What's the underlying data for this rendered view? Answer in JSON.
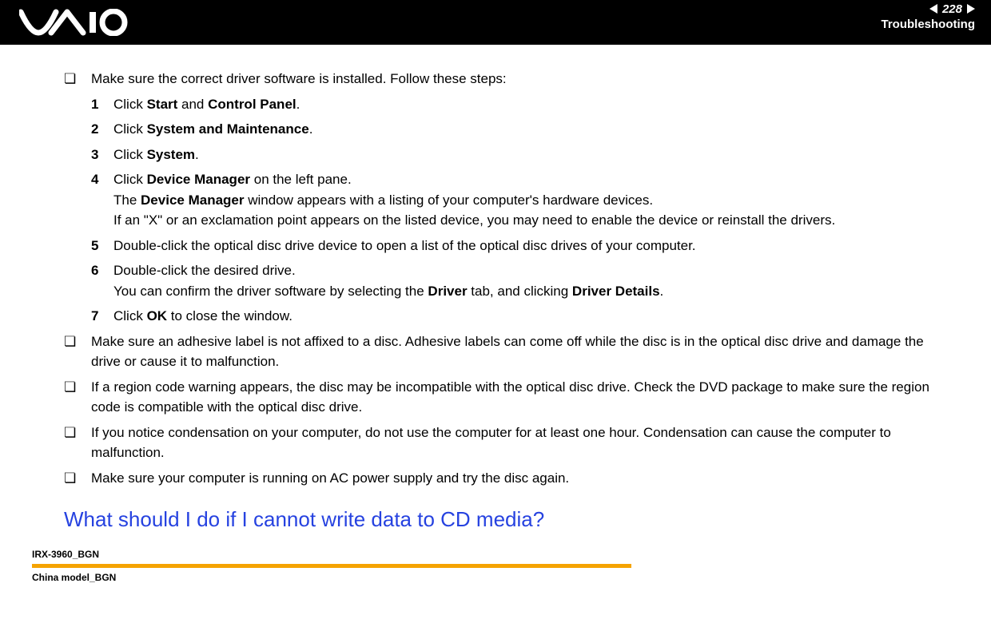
{
  "header": {
    "logo_text": "VAIO",
    "page_number": "228",
    "section": "Troubleshooting"
  },
  "content": {
    "bullet1": {
      "intro": "Make sure the correct driver software is installed. Follow these steps:",
      "steps": {
        "s1": {
          "num": "1",
          "pre": "Click ",
          "b1": "Start",
          "mid": " and ",
          "b2": "Control Panel",
          "post": "."
        },
        "s2": {
          "num": "2",
          "pre": "Click ",
          "b1": "System and Maintenance",
          "post": "."
        },
        "s3": {
          "num": "3",
          "pre": "Click ",
          "b1": "System",
          "post": "."
        },
        "s4": {
          "num": "4",
          "line1_pre": "Click ",
          "line1_b": "Device Manager",
          "line1_post": " on the left pane.",
          "line2_pre": "The ",
          "line2_b": "Device Manager",
          "line2_post": " window appears with a listing of your computer's hardware devices.",
          "line3": "If an \"X\" or an exclamation point appears on the listed device, you may need to enable the device or reinstall the drivers."
        },
        "s5": {
          "num": "5",
          "text": "Double-click the optical disc drive device to open a list of the optical disc drives of your computer."
        },
        "s6": {
          "num": "6",
          "line1": "Double-click the desired drive.",
          "line2_pre": "You can confirm the driver software by selecting the ",
          "line2_b1": "Driver",
          "line2_mid": " tab, and clicking ",
          "line2_b2": "Driver Details",
          "line2_post": "."
        },
        "s7": {
          "num": "7",
          "pre": "Click ",
          "b1": "OK",
          "post": " to close the window."
        }
      }
    },
    "bullet2": "Make sure an adhesive label is not affixed to a disc. Adhesive labels can come off while the disc is in the optical disc drive and damage the drive or cause it to malfunction.",
    "bullet3": "If a region code warning appears, the disc may be incompatible with the optical disc drive. Check the DVD package to make sure the region code is compatible with the optical disc drive.",
    "bullet4": "If you notice condensation on your computer, do not use the computer for at least one hour. Condensation can cause the computer to malfunction.",
    "bullet5": "Make sure your computer is running on AC power supply and try the disc again.",
    "heading": "What should I do if I cannot write data to CD media?"
  },
  "footer": {
    "label1": "IRX-3960_BGN",
    "label2": "China model_BGN"
  }
}
